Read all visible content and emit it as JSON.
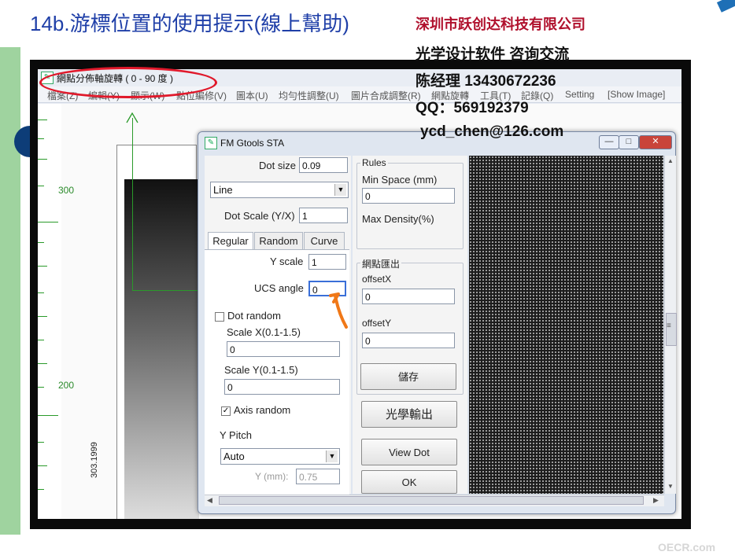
{
  "slide": {
    "title": "14b.游標位置的使用提示(線上幫助)",
    "watermark": "OECR.com"
  },
  "contact": {
    "company": "深圳市跃创达科技有限公司",
    "service": "光学设计软件  咨询交流",
    "manager": "陈经理   13430672236",
    "qq": "QQ：569192379",
    "email": "ycd_chen@126.com"
  },
  "app": {
    "title": "網點分佈軸旋轉 ( 0 - 90 度 )",
    "menu": [
      "檔案(Z)",
      "編輯(Y)",
      "顯示(W)",
      "點位編修(V)",
      "圖本(U)",
      "均勻性調整(U)",
      "圖片合成調整(R)",
      "網點旋轉",
      "工具(T)",
      "記錄(Q)",
      "Setting",
      "[Show Image]"
    ],
    "ruler_labels": [
      "300",
      "200"
    ],
    "vertical_label": "303.1999"
  },
  "dialog": {
    "title": "FM  Gtools STA",
    "window_buttons": [
      "—",
      "□",
      "✕"
    ],
    "dot_size_label": "Dot size",
    "dot_size_value": "0.09",
    "pattern_value": "Line",
    "dot_scale_label": "Dot Scale (Y/X)",
    "dot_scale_value": "1",
    "tabs": [
      "Regular",
      "Random",
      "Curve"
    ],
    "y_scale_label": "Y scale",
    "y_scale_value": "1",
    "ucs_angle_label": "UCS angle",
    "ucs_angle_value": "0",
    "dot_random_label": "Dot random",
    "scale_x_label": "Scale X(0.1-1.5)",
    "scale_x_value": "0",
    "scale_y_label": "Scale Y(0.1-1.5)",
    "scale_y_value": "0",
    "axis_random_label": "Axis random",
    "axis_random_checked": "✓",
    "y_pitch_label": "Y Pitch",
    "y_pitch_value": "Auto",
    "y_mm_label": "Y (mm):",
    "y_mm_value": "0.75",
    "rules_title": "Rules",
    "min_space_label": "Min Space (mm)",
    "min_space_value": "0",
    "max_density_label": "Max Density(%)",
    "export_title": "網點匯出",
    "offset_x_label": "offsetX",
    "offset_x_value": "0",
    "offset_y_label": "offsetY",
    "offset_y_value": "0",
    "save_button": "儲存",
    "optical_output_button": "光學輸出",
    "view_dot_button": "View Dot",
    "ok_button": "OK",
    "scroll_grip": "≡"
  }
}
